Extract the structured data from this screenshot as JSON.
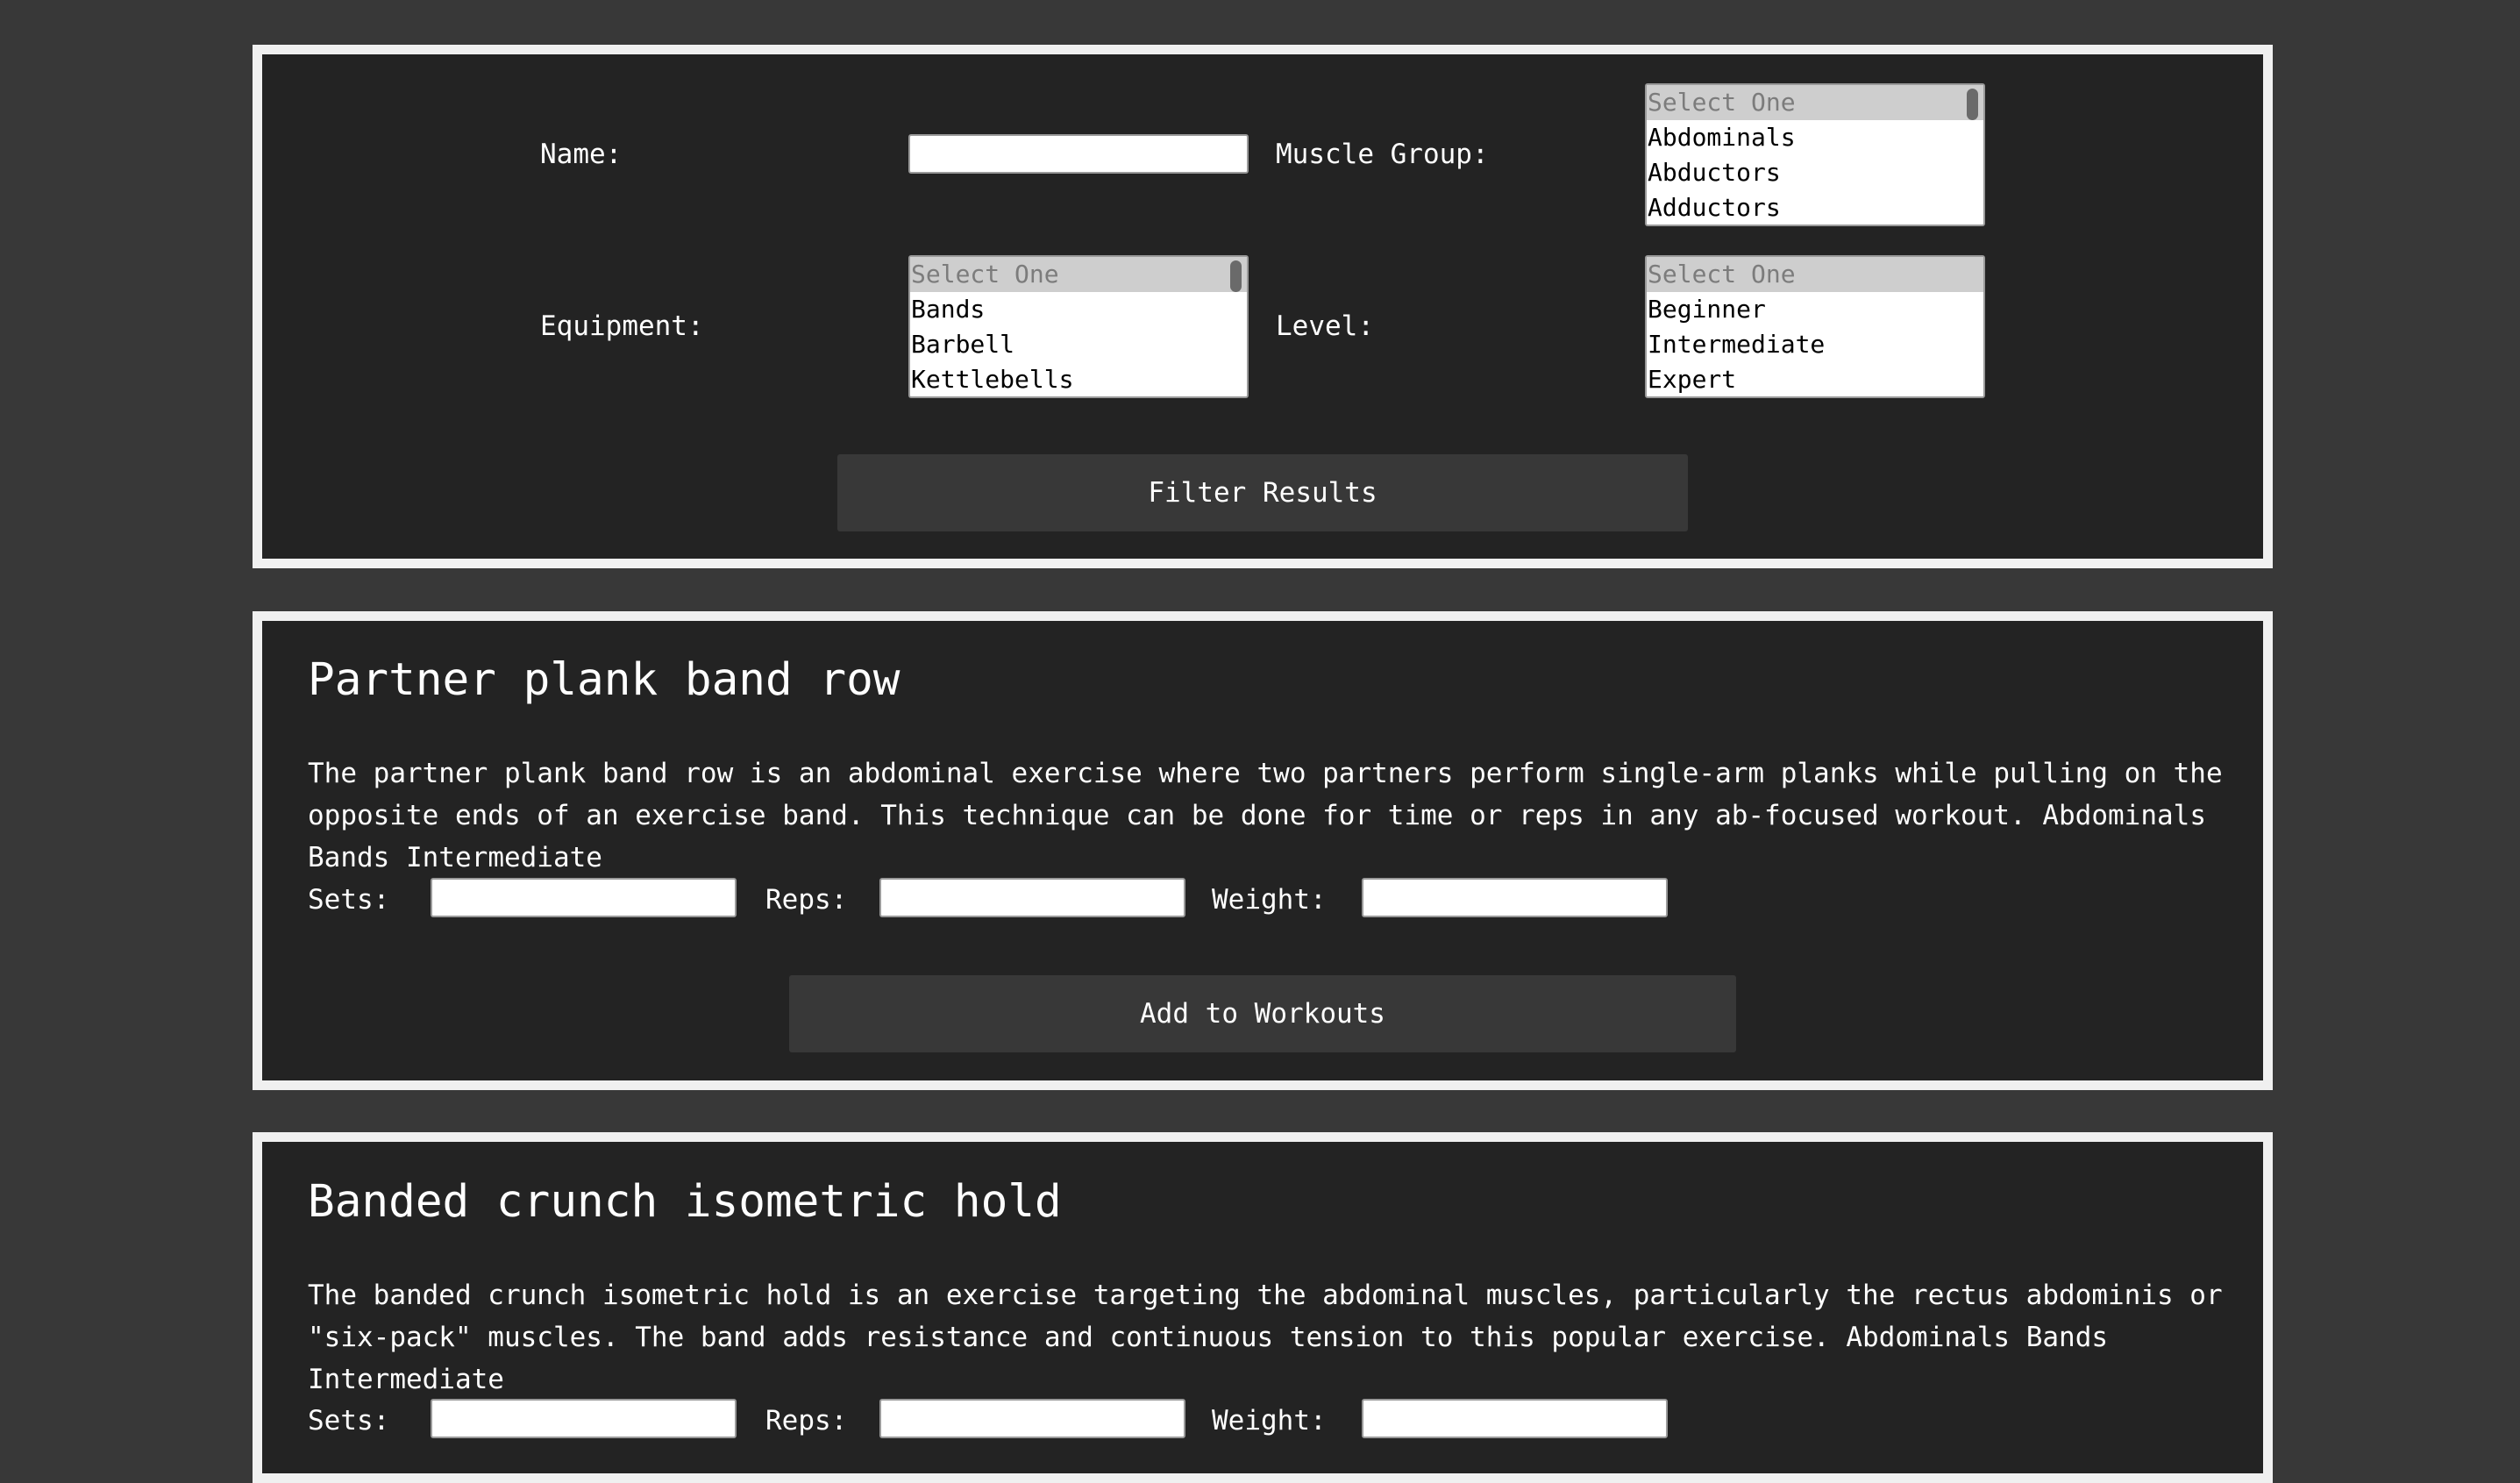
{
  "filters": {
    "name_label": "Name:",
    "name_value": "",
    "muscle_label": "Muscle Group:",
    "muscle_options": [
      "Select One",
      "Abdominals",
      "Abductors",
      "Adductors"
    ],
    "equipment_label": "Equipment:",
    "equipment_options": [
      "Select One",
      "Bands",
      "Barbell",
      "Kettlebells"
    ],
    "level_label": "Level:",
    "level_options": [
      "Select One",
      "Beginner",
      "Intermediate",
      "Expert"
    ],
    "filter_button": "Filter Results"
  },
  "exercises": [
    {
      "title": "Partner plank band row",
      "description": "The partner plank band row is an abdominal exercise where two partners perform single-arm planks while pulling on the opposite ends of an exercise band. This technique can be done for time or reps in any ab-focused workout.",
      "muscle": "Abdominals",
      "equipment": "Bands",
      "level": "Intermediate",
      "sets_label": "Sets:",
      "reps_label": "Reps:",
      "weight_label": "Weight:",
      "add_button": "Add to Workouts"
    },
    {
      "title": "Banded crunch isometric hold",
      "description": "The banded crunch isometric hold is an exercise targeting the abdominal muscles, particularly the rectus abdominis or \"six-pack\" muscles. The band adds resistance and continuous tension to this popular exercise.",
      "muscle": "Abdominals",
      "equipment": "Bands",
      "level": "Intermediate",
      "sets_label": "Sets:",
      "reps_label": "Reps:",
      "weight_label": "Weight:"
    }
  ]
}
